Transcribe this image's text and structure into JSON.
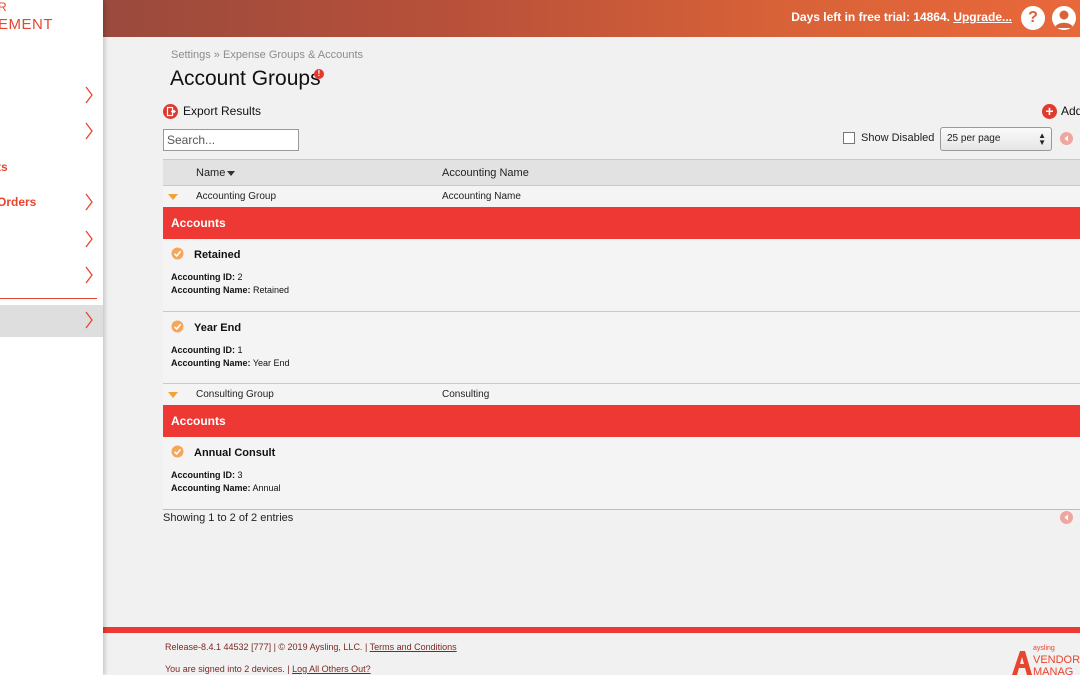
{
  "colors": {
    "brand_red": "#ee3833",
    "accent_orange": "#e8452f",
    "topbar_gradient_end": "#e8683a"
  },
  "sidebar": {
    "logo_line1": "R",
    "logo_line2": "EMENT",
    "items": [
      {
        "label": "",
        "chevron": true
      },
      {
        "label": "",
        "chevron": true
      },
      {
        "label": "ts",
        "chevron": false
      },
      {
        "label": "Orders",
        "chevron": true
      },
      {
        "label": "",
        "chevron": true
      },
      {
        "label": "",
        "chevron": true
      },
      {
        "label": "",
        "chevron": true,
        "active": true
      }
    ]
  },
  "topbar": {
    "trial_text": "Days left in free trial: 14864. ",
    "upgrade_link": "Upgrade...",
    "help_icon": "?"
  },
  "breadcrumb": "Settings » Expense Groups & Accounts",
  "page": {
    "title": "Account Groups",
    "title_badge": "!",
    "export_label": "Export Results",
    "add_label": "Add"
  },
  "filters": {
    "search_placeholder": "Search...",
    "show_disabled_label": "Show Disabled",
    "per_page": "25 per page"
  },
  "table": {
    "columns": [
      "Name",
      "Accounting Name"
    ],
    "accounts_band_label": "Accounts",
    "field_id_label": "Accounting ID:",
    "field_name_label": "Accounting Name:",
    "groups": [
      {
        "name": "Accounting Group",
        "accounting_name": "Accounting Name",
        "accounts": [
          {
            "name": "Retained",
            "id": "2",
            "accounting_name": "Retained"
          },
          {
            "name": "Year End",
            "id": "1",
            "accounting_name": "Year End"
          }
        ]
      },
      {
        "name": "Consulting Group",
        "accounting_name": "Consulting",
        "accounts": [
          {
            "name": "Annual Consult",
            "id": "3",
            "accounting_name": "Annual"
          }
        ]
      }
    ]
  },
  "showing_text": "Showing 1 to 2 of 2 entries",
  "footer": {
    "release": "Release-8.4.1 44532 [777] | © 2019 Aysling, LLC. | ",
    "terms_link": "Terms and Conditions",
    "signed_in": "You are signed into 2 devices. | ",
    "logout_link": "Log All Others Out?",
    "brand_small": "aysling",
    "brand_line1": "VENDOR",
    "brand_line2": "MANAG"
  }
}
